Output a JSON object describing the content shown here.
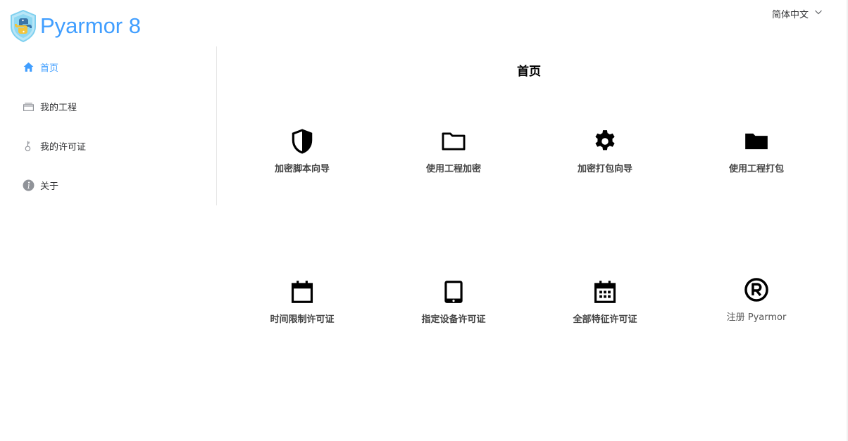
{
  "header": {
    "app_title": "Pyarmor 8",
    "language": "简体中文"
  },
  "sidebar": {
    "items": [
      {
        "label": "首页",
        "icon": "home-icon",
        "active": true
      },
      {
        "label": "我的工程",
        "icon": "box-icon",
        "active": false
      },
      {
        "label": "我的许可证",
        "icon": "key-icon",
        "active": false
      },
      {
        "label": "关于",
        "icon": "info-icon",
        "active": false
      }
    ]
  },
  "main": {
    "title": "首页",
    "cards": [
      {
        "label": "加密脚本向导",
        "icon": "shield-icon"
      },
      {
        "label": "使用工程加密",
        "icon": "folder-outline-icon"
      },
      {
        "label": "加密打包向导",
        "icon": "gear-icon"
      },
      {
        "label": "使用工程打包",
        "icon": "folder-filled-icon"
      },
      {
        "label": "时间限制许可证",
        "icon": "calendar-icon"
      },
      {
        "label": "指定设备许可证",
        "icon": "tablet-icon"
      },
      {
        "label": "全部特征许可证",
        "icon": "calendar-grid-icon"
      },
      {
        "label": "注册 Pyarmor",
        "icon": "registered-icon"
      }
    ]
  },
  "colors": {
    "accent": "#409eff",
    "text": "#303133"
  }
}
